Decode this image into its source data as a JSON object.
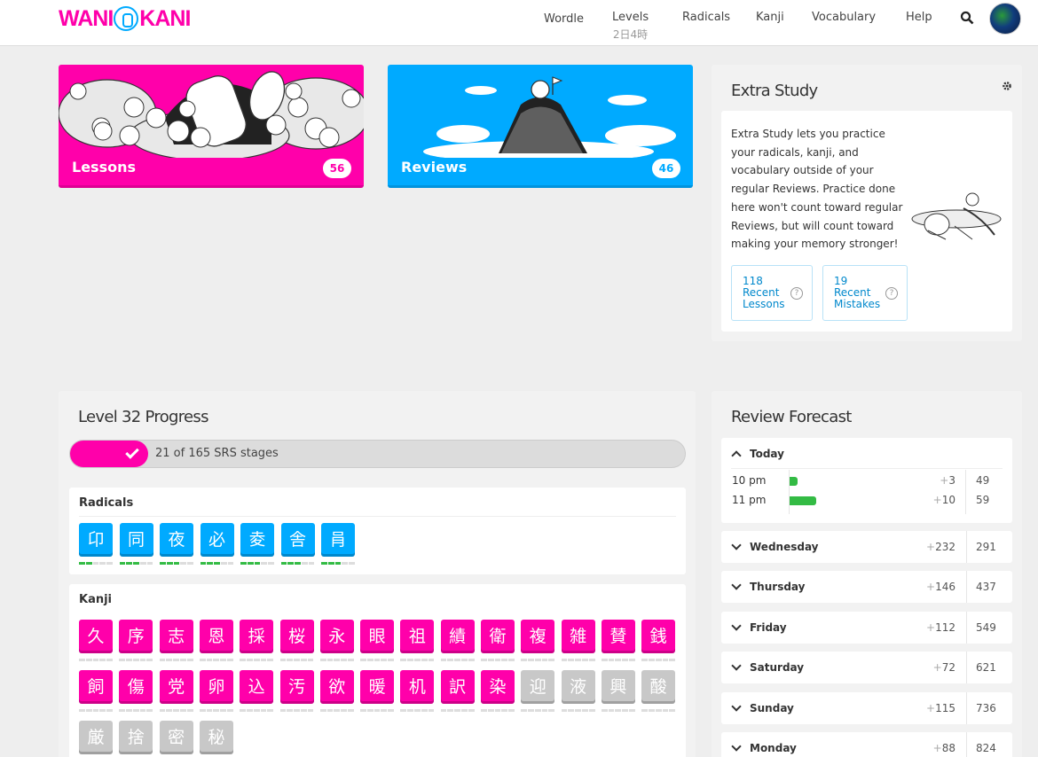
{
  "nav": {
    "logo": "WANIKANI",
    "items": [
      {
        "label": "Wordle",
        "sub": ""
      },
      {
        "label": "Levels",
        "sub": "2日4時"
      },
      {
        "label": "Radicals",
        "sub": ""
      },
      {
        "label": "Kanji",
        "sub": ""
      },
      {
        "label": "Vocabulary",
        "sub": ""
      },
      {
        "label": "Help",
        "sub": ""
      }
    ]
  },
  "lessons": {
    "label": "Lessons",
    "count": "56"
  },
  "reviews": {
    "label": "Reviews",
    "count": "46"
  },
  "extra_study": {
    "title": "Extra Study",
    "description": "Extra Study lets you practice your radicals, kanji, and vocabulary outside of your regular Reviews. Practice done here won't count toward regular Reviews, but will count toward making your memory stronger!",
    "recent_lessons": {
      "count": "118",
      "label1": "Recent",
      "label2": "Lessons"
    },
    "recent_mistakes": {
      "count": "19",
      "label1": "Recent",
      "label2": "Mistakes"
    }
  },
  "level_progress": {
    "title": "Level 32 Progress",
    "progress_text": "21 of 165 SRS stages",
    "fraction": 0.127,
    "radicals_title": "Radicals",
    "radicals": [
      {
        "char": "卬",
        "stage": 2
      },
      {
        "char": "同",
        "stage": 3
      },
      {
        "char": "夜",
        "stage": 3
      },
      {
        "char": "必",
        "stage": 3
      },
      {
        "char": "夌",
        "stage": 3
      },
      {
        "char": "舎",
        "stage": 3
      },
      {
        "char": "肙",
        "stage": 3
      }
    ],
    "kanji_title": "Kanji",
    "kanji": [
      {
        "char": "久",
        "locked": false
      },
      {
        "char": "序",
        "locked": false
      },
      {
        "char": "志",
        "locked": false
      },
      {
        "char": "恩",
        "locked": false
      },
      {
        "char": "採",
        "locked": false
      },
      {
        "char": "桜",
        "locked": false
      },
      {
        "char": "永",
        "locked": false
      },
      {
        "char": "眼",
        "locked": false
      },
      {
        "char": "祖",
        "locked": false
      },
      {
        "char": "績",
        "locked": false
      },
      {
        "char": "衛",
        "locked": false
      },
      {
        "char": "複",
        "locked": false
      },
      {
        "char": "雑",
        "locked": false
      },
      {
        "char": "賛",
        "locked": false
      },
      {
        "char": "銭",
        "locked": false
      },
      {
        "char": "飼",
        "locked": false
      },
      {
        "char": "傷",
        "locked": false
      },
      {
        "char": "党",
        "locked": false
      },
      {
        "char": "卵",
        "locked": false
      },
      {
        "char": "込",
        "locked": false
      },
      {
        "char": "汚",
        "locked": false
      },
      {
        "char": "欲",
        "locked": false
      },
      {
        "char": "暖",
        "locked": false
      },
      {
        "char": "机",
        "locked": false
      },
      {
        "char": "訳",
        "locked": false
      },
      {
        "char": "染",
        "locked": false
      },
      {
        "char": "迎",
        "locked": true
      },
      {
        "char": "液",
        "locked": true
      },
      {
        "char": "興",
        "locked": true
      },
      {
        "char": "酸",
        "locked": true
      },
      {
        "char": "厳",
        "locked": true
      },
      {
        "char": "捨",
        "locked": true
      },
      {
        "char": "密",
        "locked": true
      },
      {
        "char": "秘",
        "locked": true
      }
    ]
  },
  "forecast": {
    "title": "Review Forecast",
    "today": {
      "label": "Today",
      "hours": [
        {
          "time": "10 pm",
          "plus": "3",
          "total": "49",
          "fraction": 0.03
        },
        {
          "time": "11 pm",
          "plus": "10",
          "total": "59",
          "fraction": 0.1
        }
      ]
    },
    "days": [
      {
        "label": "Wednesday",
        "plus": "232",
        "total": "291"
      },
      {
        "label": "Thursday",
        "plus": "146",
        "total": "437"
      },
      {
        "label": "Friday",
        "plus": "112",
        "total": "549"
      },
      {
        "label": "Saturday",
        "plus": "72",
        "total": "621"
      },
      {
        "label": "Sunday",
        "plus": "115",
        "total": "736"
      },
      {
        "label": "Monday",
        "plus": "88",
        "total": "824"
      }
    ]
  },
  "colors": {
    "radical": "#00aaff",
    "kanji": "#ff00aa",
    "locked": "#c8c8c8",
    "srs_bar": "#33bb44"
  }
}
